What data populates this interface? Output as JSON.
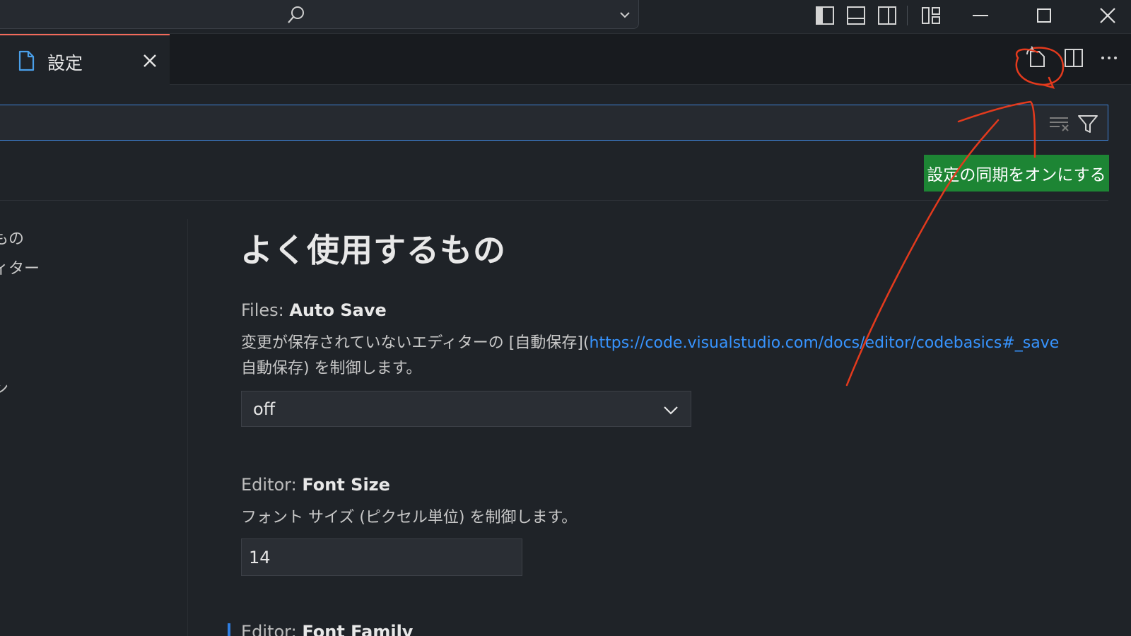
{
  "colors": {
    "accent_blue": "#3f82d6",
    "tab_indicator": "#f26a5b",
    "tooltip_bg": "#1d8534",
    "link": "#3794ff",
    "annotation_red": "#e33a1d"
  },
  "titlebar": {
    "icons": [
      "search-icon",
      "chevron-down-icon",
      "toggle-primary-sidebar-icon",
      "toggle-panel-icon",
      "toggle-secondary-sidebar-icon",
      "customize-layout-icon",
      "minimize-icon",
      "maximize-icon",
      "close-icon"
    ]
  },
  "tab": {
    "label": "設定"
  },
  "editor_actions": {
    "icons": [
      "sync-settings-icon",
      "split-editor-icon",
      "more-actions-icon"
    ]
  },
  "search": {
    "placeholder": ""
  },
  "tooltip": {
    "text": "設定の同期をオンにする"
  },
  "toc": {
    "items": [
      "もの",
      "ィター",
      "ン"
    ]
  },
  "content": {
    "section_title": "よく使用するもの",
    "auto_save": {
      "category": "Files: ",
      "name": "Auto Save",
      "desc_prefix": "変更が保存されていないエディターの [自動保存](",
      "desc_link": "https://code.visualstudio.com/docs/editor/codebasics#_save",
      "desc_line2": "自動保存) を制御します。",
      "value": "off"
    },
    "font_size": {
      "category": "Editor: ",
      "name": "Font Size",
      "desc": "フォント サイズ (ピクセル単位) を制御します。",
      "value": "14"
    },
    "font_family": {
      "category": "Editor: ",
      "name": "Font Family"
    }
  }
}
